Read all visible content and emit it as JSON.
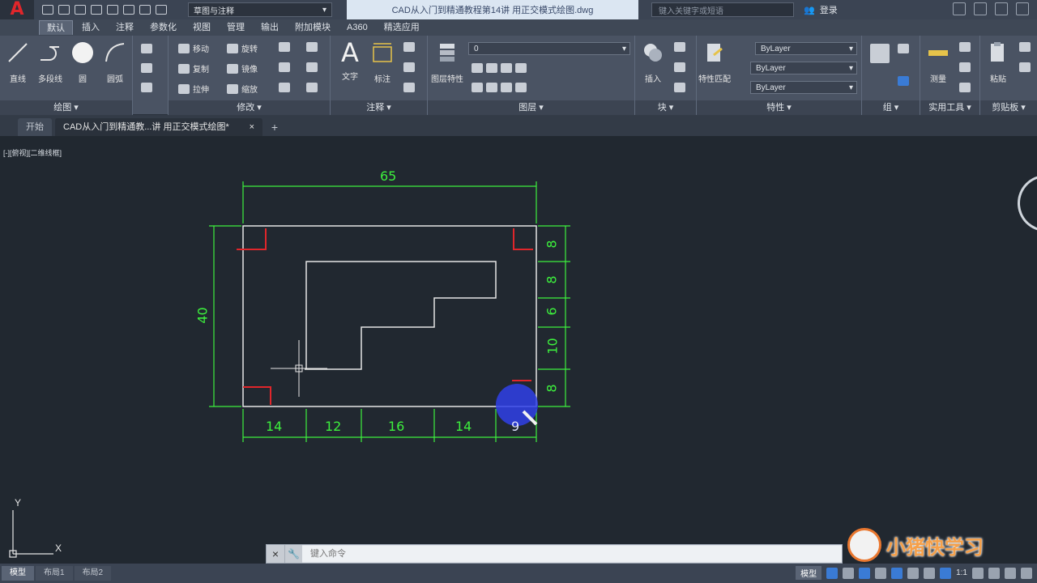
{
  "titlebar": {
    "logo": "A",
    "workspace": "草图与注释",
    "document_title": "CAD从入门到精通教程第14讲 用正交模式绘图.dwg",
    "search_placeholder": "键入关键字或短语",
    "user": "登录"
  },
  "ribbon_tabs": [
    "默认",
    "插入",
    "注释",
    "参数化",
    "视图",
    "管理",
    "输出",
    "附加模块",
    "A360",
    "精选应用"
  ],
  "ribbon": {
    "draw_panel": {
      "title": "绘图",
      "tools": [
        "直线",
        "多段线",
        "圆",
        "圆弧"
      ]
    },
    "modify_panel": {
      "title": "修改",
      "rows": [
        "移动",
        "旋转",
        "复制",
        "镜像",
        "拉伸",
        "缩放"
      ]
    },
    "annotation_panel": {
      "title": "注释",
      "tools": [
        "文字",
        "标注"
      ]
    },
    "layers_panel": {
      "title": "图层",
      "tools": [
        "图层特性"
      ],
      "current_layer": "0"
    },
    "block_panel": {
      "title": "块",
      "tools": [
        "插入"
      ]
    },
    "properties_panel": {
      "title": "特性",
      "tools": [
        "特性匹配"
      ],
      "color": "ByLayer",
      "linetype": "ByLayer",
      "lineweight": "ByLayer"
    },
    "groups_panel": {
      "title": "组"
    },
    "utilities_panel": {
      "title": "实用工具",
      "tools": [
        "测量"
      ]
    },
    "clipboard_panel": {
      "title": "剪贴板",
      "tools": [
        "粘贴"
      ]
    }
  },
  "file_tabs": {
    "start": "开始",
    "active": "CAD从入门到精通教...讲 用正交模式绘图*"
  },
  "viewport_label": "[-][俯视][二维线框]",
  "drawing": {
    "dimensions": {
      "top": "65",
      "left": "40",
      "right": [
        "8",
        "8",
        "6",
        "10",
        "8"
      ],
      "bottom": [
        "14",
        "12",
        "16",
        "14",
        "9"
      ]
    },
    "ucs": {
      "x": "X",
      "y": "Y"
    }
  },
  "command_line": {
    "placeholder": "键入命令"
  },
  "layout_tabs": [
    "模型",
    "布局1",
    "布局2"
  ],
  "status": {
    "model": "模型",
    "scale": "1:1"
  },
  "watermark": "小猪快学习",
  "colors": {
    "background": "#212830",
    "dimension": "#3df03d",
    "geometry": "#e6e6e6",
    "marker": "#e0262b",
    "cursor_highlight": "#2f3fe8"
  }
}
